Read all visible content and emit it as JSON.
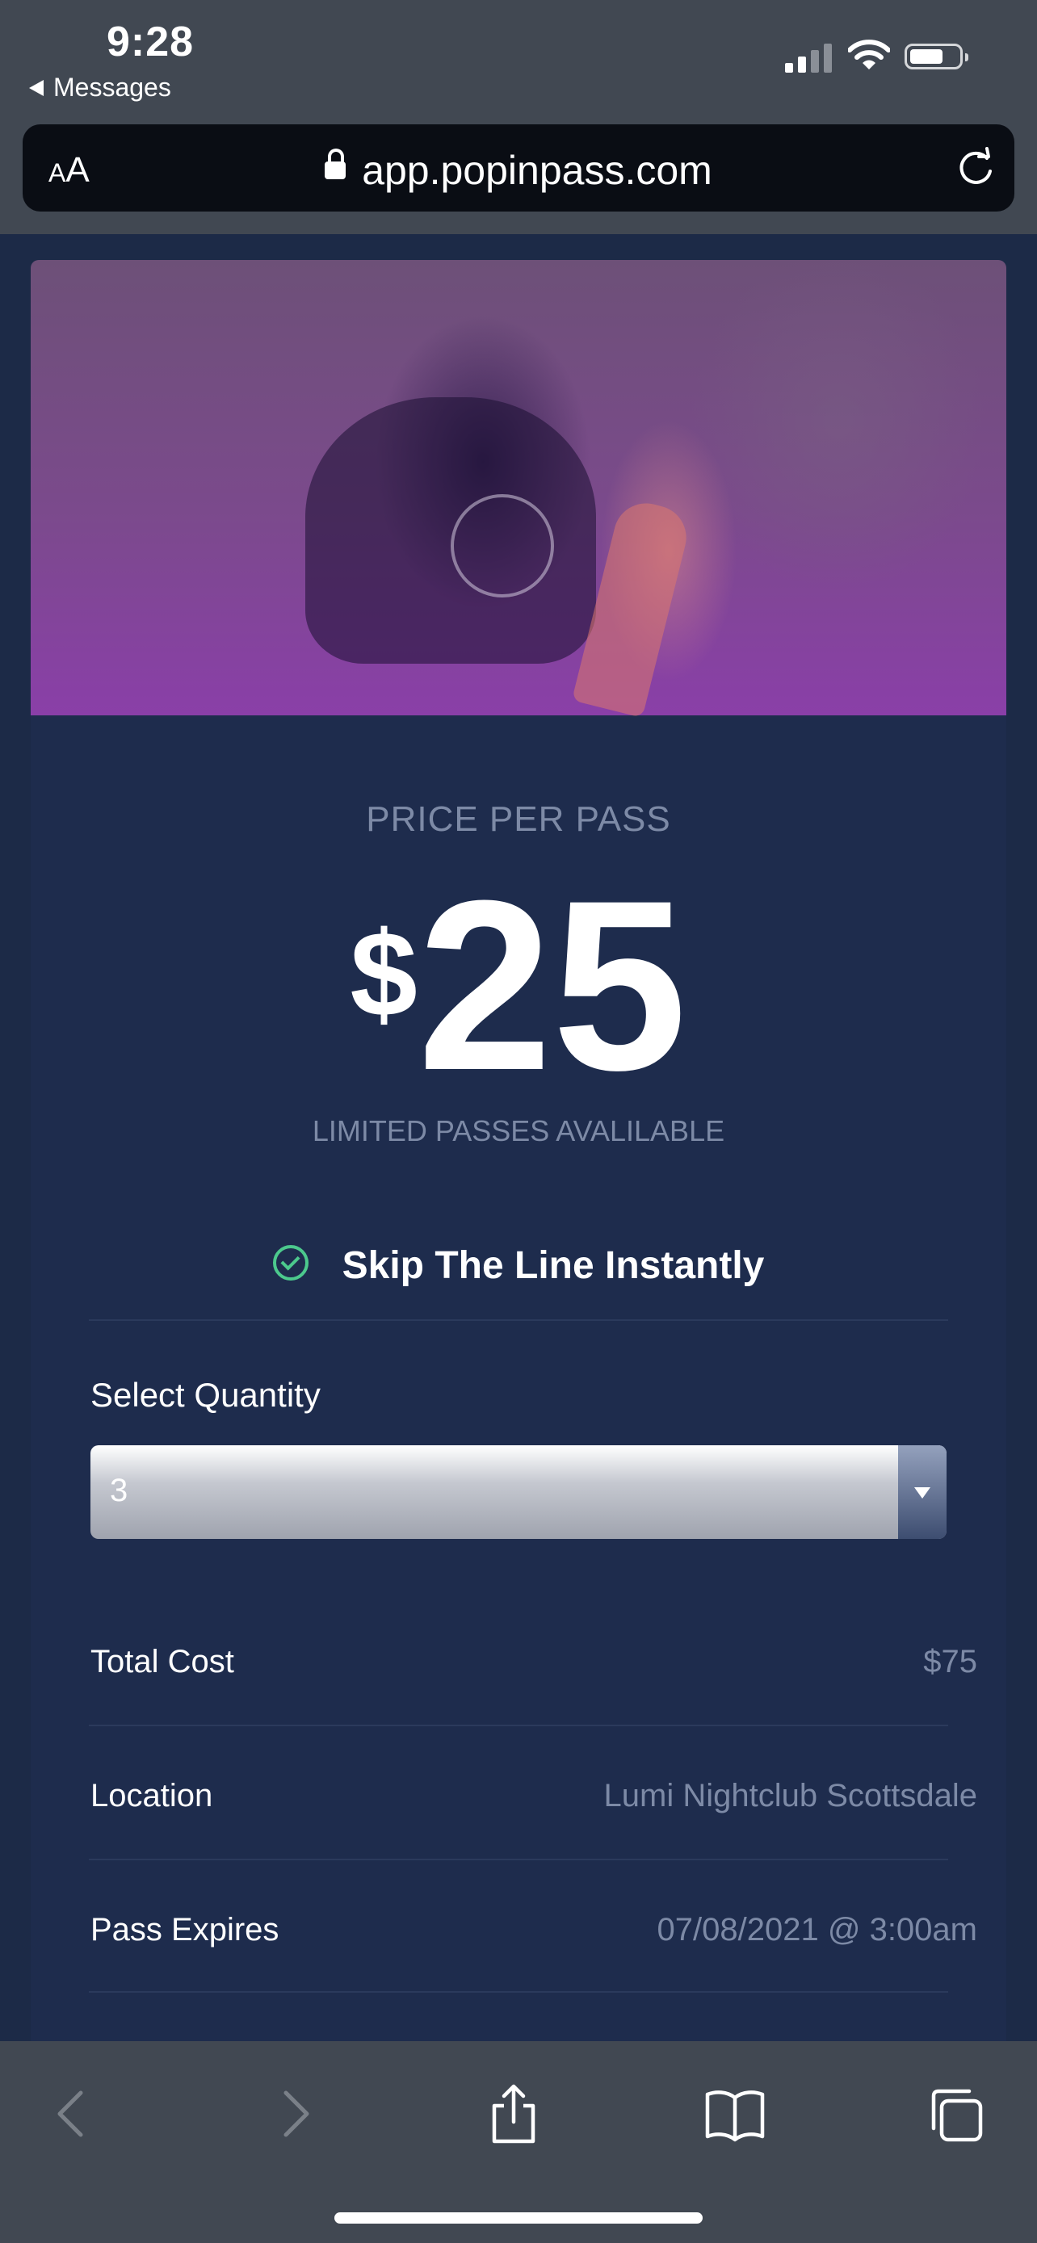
{
  "status_bar": {
    "time": "9:28",
    "back_app": "Messages"
  },
  "browser": {
    "text_size_label_small": "A",
    "text_size_label_large": "A",
    "url": "app.popinpass.com"
  },
  "pass": {
    "price_label": "PRICE PER PASS",
    "currency": "$",
    "price": "25",
    "availability": "LIMITED PASSES AVALILABLE",
    "feature": "Skip The Line Instantly",
    "quantity_label": "Select Quantity",
    "quantity_value": "3",
    "details": [
      {
        "label": "Total Cost",
        "value": "$75"
      },
      {
        "label": "Location",
        "value": "Lumi Nightclub Scottsdale"
      },
      {
        "label": "Pass Expires",
        "value": "07/08/2021 @ 3:00am"
      }
    ]
  },
  "colors": {
    "page_bg": "#1c2a47",
    "card_bg": "#1e2c4d",
    "muted_text": "#7d8aa6",
    "check_green": "#4cc98d",
    "hero_tint": "#8a3fa8"
  },
  "icons": {
    "back": "chevron-left-icon",
    "forward": "chevron-right-icon",
    "share": "share-icon",
    "bookmarks": "book-icon",
    "tabs": "tabs-icon",
    "reload": "reload-icon",
    "lock": "lock-icon",
    "check": "check-circle-icon"
  }
}
